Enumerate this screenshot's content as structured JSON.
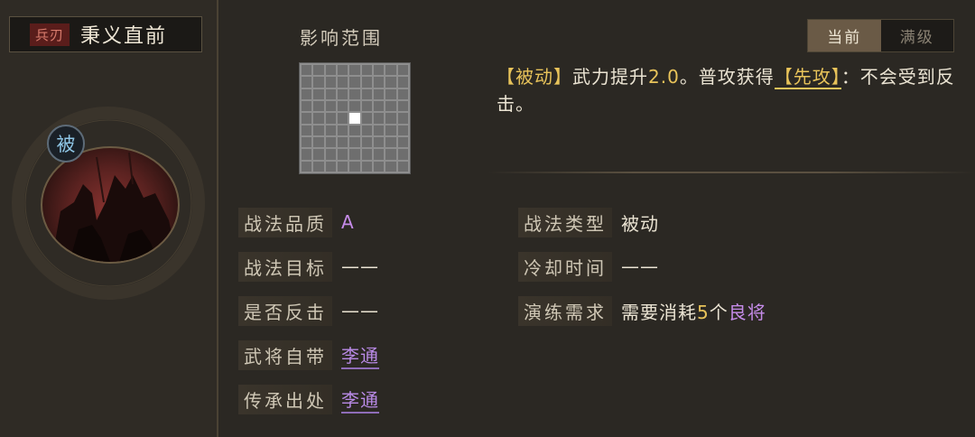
{
  "header": {
    "tag": "兵刃",
    "skill_name": "秉义直前"
  },
  "portrait": {
    "badge": "被"
  },
  "range": {
    "label": "影响范围",
    "grid_size": 9,
    "highlight_cell": [
      4,
      4
    ]
  },
  "toggle": {
    "current": "当前",
    "max": "满级",
    "active": "current"
  },
  "description": {
    "part1": "【被动】",
    "part2": "武力提升",
    "value": "2.0",
    "part3": "。普攻获得",
    "keyword": "【先攻】",
    "part4": "：不会受到反击。"
  },
  "attributes": {
    "quality_label": "战法品质",
    "quality_value": "A",
    "target_label": "战法目标",
    "target_value": "——",
    "counter_label": "是否反击",
    "counter_value": "——",
    "owner_label": "武将自带",
    "owner_value": "李通",
    "inherit_label": "传承出处",
    "inherit_value": "李通",
    "type_label": "战法类型",
    "type_value": "被动",
    "cooldown_label": "冷却时间",
    "cooldown_value": "——",
    "train_label": "演练需求",
    "train_prefix": "需要消耗",
    "train_count": "5",
    "train_unit": "个",
    "train_item": "良将"
  },
  "colors": {
    "background": "#2b2823",
    "highlight_yellow": "#e8c35a",
    "purple": "#c58be8",
    "tag_red": "#5a1d1b"
  }
}
